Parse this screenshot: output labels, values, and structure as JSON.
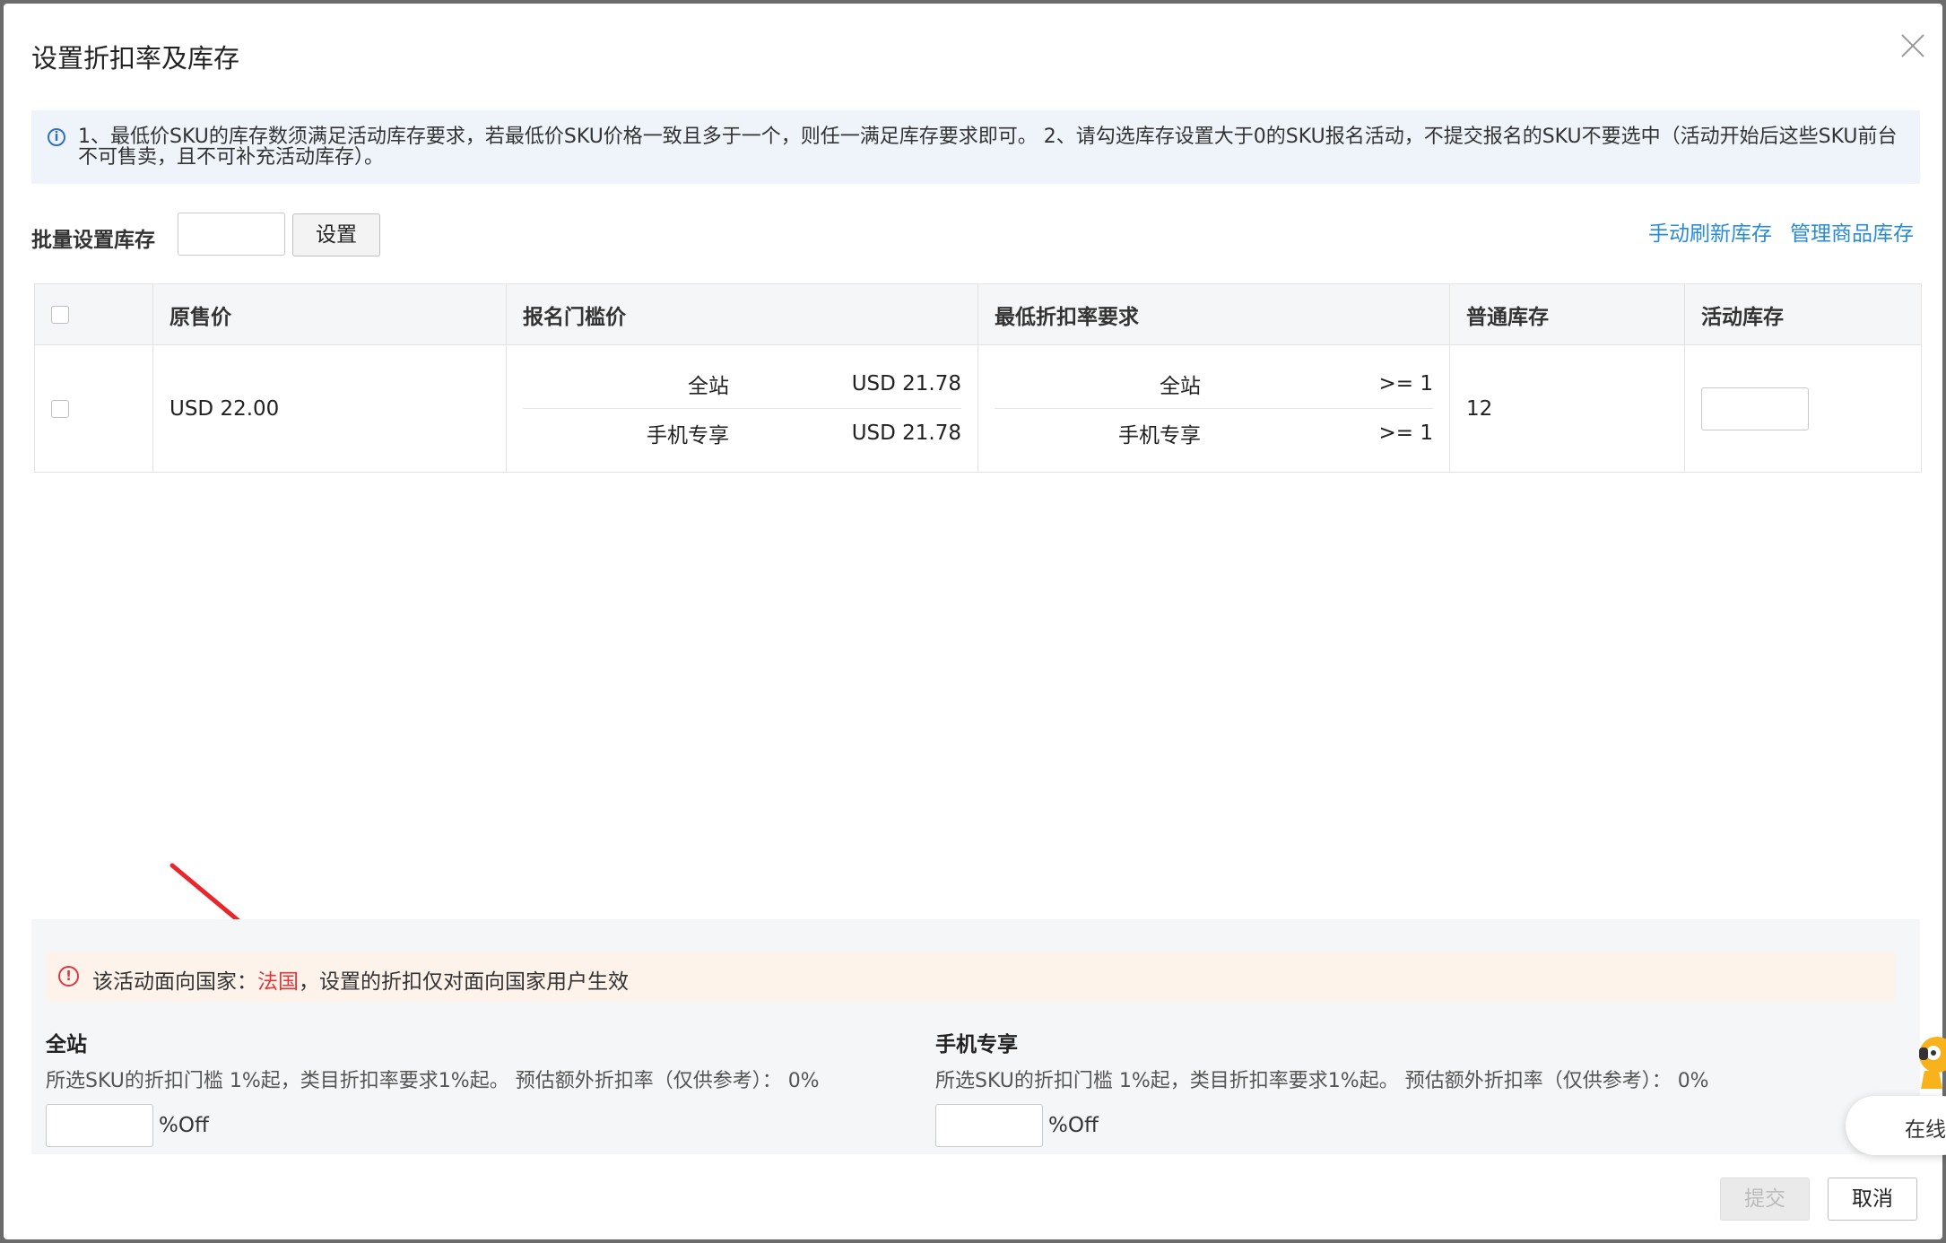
{
  "dialog": {
    "title": "设置折扣率及库存"
  },
  "notice": {
    "text": "1、最低价SKU的库存数须满足活动库存要求，若最低价SKU价格一致且多于一个，则任一满足库存要求即可。 2、请勾选库存设置大于0的SKU报名活动，不提交报名的SKU不要选中（活动开始后这些SKU前台不可售卖，且不可补充活动库存）。"
  },
  "batch": {
    "label": "批量设置库存",
    "button": "设置",
    "input_value": ""
  },
  "links": {
    "refresh": "手动刷新库存",
    "manage": "管理商品库存"
  },
  "table": {
    "headers": [
      "",
      "原售价",
      "报名门槛价",
      "最低折扣率要求",
      "普通库存",
      "活动库存"
    ],
    "rows": [
      {
        "original_price": "USD 22.00",
        "threshold": [
          {
            "site": "全站",
            "value": "USD 21.78"
          },
          {
            "site": "手机专享",
            "value": "USD 21.78"
          }
        ],
        "min_discount": [
          {
            "site": "全站",
            "value": ">= 1"
          },
          {
            "site": "手机专享",
            "value": ">= 1"
          }
        ],
        "normal_stock": "12",
        "activity_stock": ""
      }
    ]
  },
  "warning": {
    "prefix": "该活动面向国家：",
    "country": "法国",
    "suffix": "，设置的折扣仅对面向国家用户生效"
  },
  "sites": [
    {
      "name": "全站",
      "desc": "所选SKU的折扣门槛 1%起，类目折扣率要求1%起。 预估额外折扣率（仅供参考）： 0%",
      "unit": "%Off",
      "value": ""
    },
    {
      "name": "手机专享",
      "desc": "所选SKU的折扣门槛 1%起，类目折扣率要求1%起。 预估额外折扣率（仅供参考）： 0%",
      "unit": "%Off",
      "value": ""
    }
  ],
  "buttons": {
    "submit": "提交",
    "cancel": "取消"
  },
  "chat": {
    "label": "在线"
  },
  "colors": {
    "link": "#2a8bd4",
    "warning_red": "#e0383e",
    "info_blue": "#2f6fc9"
  }
}
